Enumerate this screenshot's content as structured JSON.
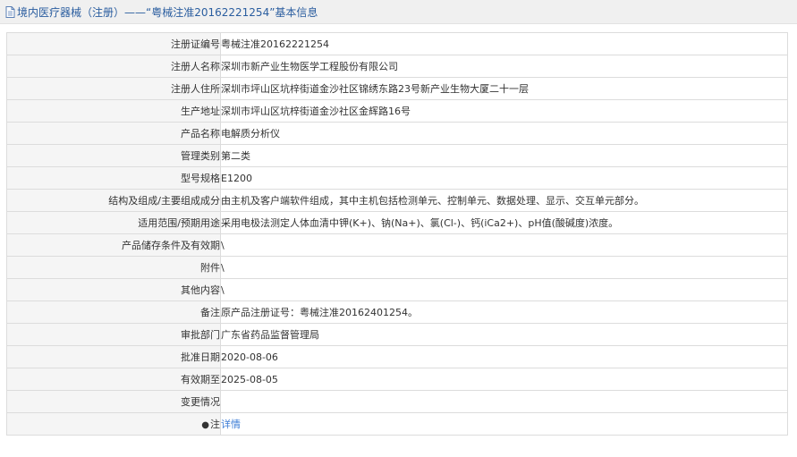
{
  "header": {
    "title": "境内医疗器械（注册）——“粤械注准20162221254”基本信息",
    "icon": "document-icon"
  },
  "rows": [
    {
      "label": "注册证编号",
      "value": "粤械注准20162221254"
    },
    {
      "label": "注册人名称",
      "value": "深圳市新产业生物医学工程股份有限公司"
    },
    {
      "label": "注册人住所",
      "value": "深圳市坪山区坑梓街道金沙社区锦绣东路23号新产业生物大厦二十一层"
    },
    {
      "label": "生产地址",
      "value": "深圳市坪山区坑梓街道金沙社区金辉路16号"
    },
    {
      "label": "产品名称",
      "value": "电解质分析仪"
    },
    {
      "label": "管理类别",
      "value": "第二类"
    },
    {
      "label": "型号规格",
      "value": "E1200"
    },
    {
      "label": "结构及组成/主要组成成分",
      "value": "由主机及客户端软件组成，其中主机包括检测单元、控制单元、数据处理、显示、交互单元部分。"
    },
    {
      "label": "适用范围/预期用途",
      "value": "采用电极法测定人体血清中钾(K+)、钠(Na+)、氯(Cl-)、钙(iCa2+)、pH值(酸碱度)浓度。"
    },
    {
      "label": "产品储存条件及有效期",
      "value": "\\"
    },
    {
      "label": "附件",
      "value": "\\"
    },
    {
      "label": "其他内容",
      "value": "\\"
    },
    {
      "label": "备注",
      "value": "原产品注册证号：粤械注准20162401254。"
    },
    {
      "label": "审批部门",
      "value": "广东省药品监督管理局"
    },
    {
      "label": "批准日期",
      "value": "2020-08-06"
    },
    {
      "label": "有效期至",
      "value": "2025-08-05"
    },
    {
      "label": "变更情况",
      "value": ""
    }
  ],
  "note_row": {
    "icon": "pin-icon",
    "label": "注",
    "link_text": "详情"
  }
}
